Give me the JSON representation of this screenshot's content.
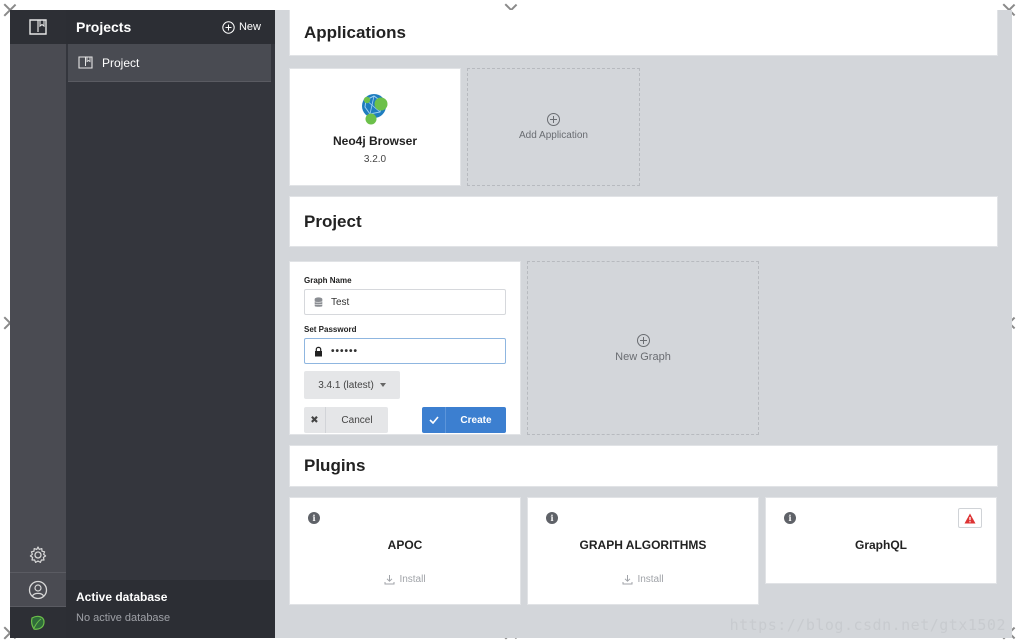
{
  "sidebar": {
    "projects_title": "Projects",
    "new_label": "New",
    "items": [
      {
        "label": "Project"
      }
    ],
    "active_db_title": "Active database",
    "active_db_value": "No active database"
  },
  "applications": {
    "title": "Applications",
    "apps": [
      {
        "name": "Neo4j Browser",
        "version": "3.2.0"
      }
    ],
    "add_label": "Add Application"
  },
  "project": {
    "title": "Project",
    "graph_name_label": "Graph Name",
    "graph_name_value": "Test",
    "password_label": "Set Password",
    "password_value": "••••••",
    "version_value": "3.4.1 (latest)",
    "cancel_label": "Cancel",
    "create_label": "Create",
    "new_graph_label": "New Graph"
  },
  "plugins": {
    "title": "Plugins",
    "install_label": "Install",
    "items": [
      {
        "name": "APOC"
      },
      {
        "name": "GRAPH ALGORITHMS"
      },
      {
        "name": "GraphQL"
      }
    ]
  },
  "watermark": "https://blog.csdn.net/gtx1502",
  "colors": {
    "accent": "#3c7fd0",
    "neo4j_green": "#6cc04a",
    "neo4j_blue": "#1f7dbf",
    "warning": "#d33"
  }
}
